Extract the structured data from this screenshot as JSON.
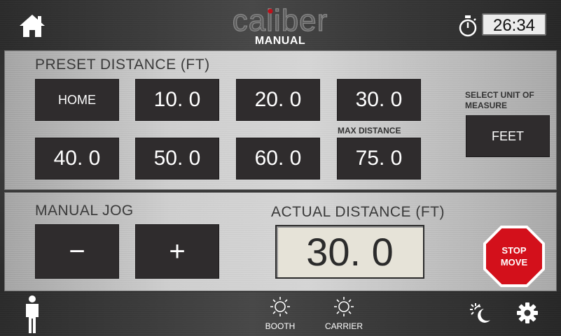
{
  "header": {
    "logo_text": "caliber",
    "mode": "MANUAL",
    "timer": "26:34"
  },
  "preset": {
    "title": "PRESET DISTANCE (FT)",
    "buttons": [
      "HOME",
      "10. 0",
      "20. 0",
      "30. 0",
      "40. 0",
      "50. 0",
      "60. 0",
      "75. 0"
    ],
    "max_distance_label": "MAX DISTANCE",
    "unit_label": "SELECT UNIT OF MEASURE",
    "unit_value": "FEET"
  },
  "jog": {
    "title": "MANUAL JOG",
    "minus": "−",
    "plus": "+"
  },
  "actual": {
    "title": "ACTUAL DISTANCE (FT)",
    "value": "30. 0"
  },
  "stop": {
    "line1": "STOP",
    "line2": "MOVE",
    "color": "#d3101b"
  },
  "bottom": {
    "booth_label": "BOOTH",
    "carrier_label": "CARRIER"
  },
  "icons": [
    "home-icon",
    "stopwatch-icon",
    "person-icon",
    "light-icon",
    "day-night-icon",
    "gear-icon"
  ]
}
